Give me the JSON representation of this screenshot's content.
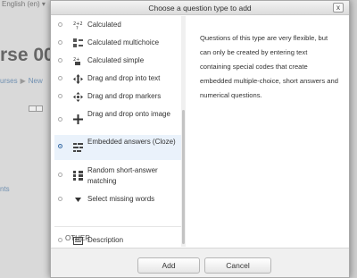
{
  "background": {
    "language": "English (en) ▾",
    "course_title": "rse 00",
    "breadcrumbs": [
      "urses",
      "New"
    ],
    "breadcrumb_sep": "▶",
    "side_text": "nts"
  },
  "dialog": {
    "title": "Choose a question type to add",
    "close_label": "x",
    "questions": [
      {
        "label": "Calculated",
        "icon": "calculated-icon",
        "selected": false
      },
      {
        "label": "Calculated multichoice",
        "icon": "calculated-multichoice-icon",
        "selected": false
      },
      {
        "label": "Calculated simple",
        "icon": "calculated-simple-icon",
        "selected": false
      },
      {
        "label": "Drag and drop into text",
        "icon": "drag-drop-text-icon",
        "selected": false
      },
      {
        "label": "Drag and drop markers",
        "icon": "drag-drop-markers-icon",
        "selected": false
      },
      {
        "label": "Drag and drop onto image",
        "icon": "drag-drop-image-icon",
        "selected": false
      },
      {
        "label": "Embedded answers (Cloze)",
        "icon": "embedded-answers-icon",
        "selected": true
      },
      {
        "label": "Random short-answer matching",
        "icon": "random-matching-icon",
        "selected": false
      },
      {
        "label": "Select missing words",
        "icon": "select-missing-words-icon",
        "selected": false
      }
    ],
    "other_heading": "OTHER",
    "other_items": [
      {
        "label": "Description",
        "icon": "description-icon",
        "selected": false
      }
    ],
    "description": "Questions of this type are very flexible, but can only be created by entering text containing special codes that create embedded multiple-choice, short answers and numerical questions.",
    "add_label": "Add",
    "cancel_label": "Cancel",
    "accent_color": "#3a6ea8"
  }
}
